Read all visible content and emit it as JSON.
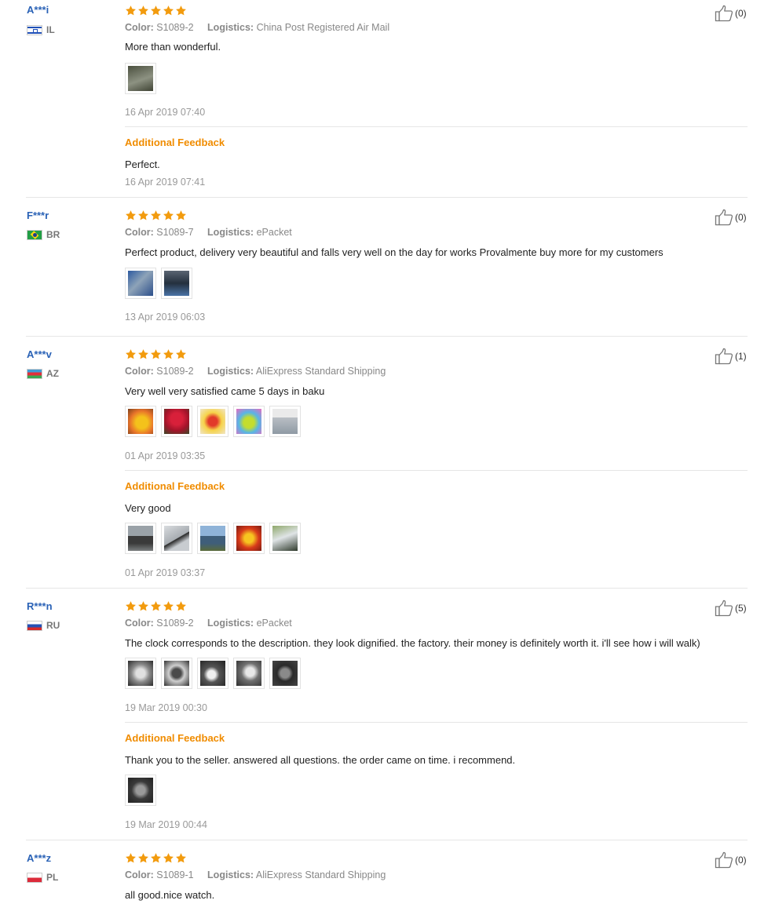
{
  "labels": {
    "color": "Color:",
    "logistics": "Logistics:",
    "additional": "Additional Feedback"
  },
  "reviews": [
    {
      "user": "A***i",
      "country": "IL",
      "flag": "il",
      "color": "S1089-2",
      "logistics": "China Post Registered Air Mail",
      "text": "More than wonderful.",
      "date": "16 Apr 2019 07:40",
      "likes": "(0)",
      "additional": {
        "text": "Perfect.",
        "date": "16 Apr 2019 07:41"
      }
    },
    {
      "user": "F***r",
      "country": "BR",
      "flag": "br",
      "color": "S1089-7",
      "logistics": "ePacket",
      "text": "Perfect product, delivery very beautiful and falls very well on the day for works Provalmente buy more for my customers",
      "date": "13 Apr 2019 06:03",
      "likes": "(0)"
    },
    {
      "user": "A***v",
      "country": "AZ",
      "flag": "az",
      "color": "S1089-2",
      "logistics": "AliExpress Standard Shipping",
      "text": "Very well very satisfied came 5 days in baku",
      "date": "01 Apr 2019 03:35",
      "likes": "(1)",
      "additional": {
        "text": "Very good",
        "date": "01 Apr 2019 03:37"
      }
    },
    {
      "user": "R***n",
      "country": "RU",
      "flag": "ru",
      "color": "S1089-2",
      "logistics": "ePacket",
      "text": "The clock corresponds to the description. they look dignified. the factory. their money is definitely worth it. i'll see how i will walk)",
      "date": "19 Mar 2019 00:30",
      "likes": "(5)",
      "additional": {
        "text": "Thank you to the seller. answered all questions. the order came on time. i recommend.",
        "date": "19 Mar 2019 00:44"
      }
    },
    {
      "user": "A***z",
      "country": "PL",
      "flag": "pl",
      "color": "S1089-1",
      "logistics": "AliExpress Standard Shipping",
      "text": "all good.nice watch.",
      "likes": "(0)"
    }
  ]
}
